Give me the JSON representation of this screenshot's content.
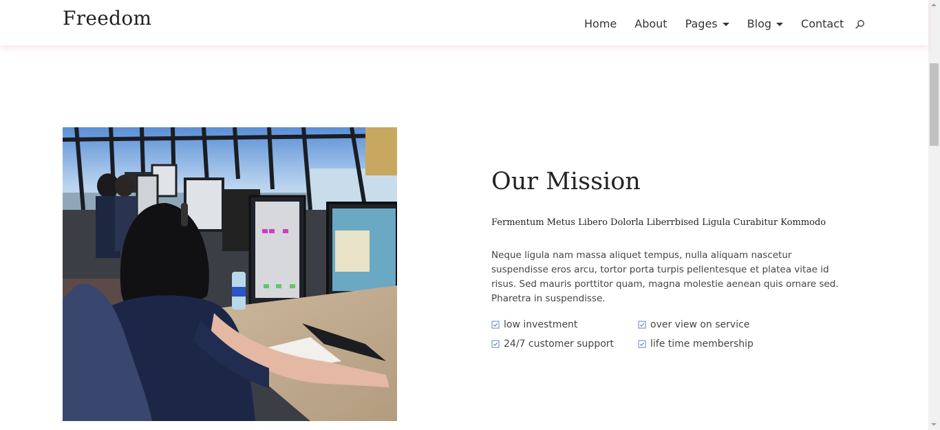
{
  "header": {
    "logo": "Freedom",
    "nav": [
      {
        "label": "Home",
        "dropdown": false
      },
      {
        "label": "About",
        "dropdown": false
      },
      {
        "label": "Pages",
        "dropdown": true
      },
      {
        "label": "Blog",
        "dropdown": true
      },
      {
        "label": "Contact",
        "dropdown": false
      }
    ],
    "search_icon": "search-icon"
  },
  "mission": {
    "title": "Our Mission",
    "subtitle": "Fermentum Metus Libero Dolorla Liberrbised Ligula Curabitur Kommodo",
    "paragraph": "Neque ligula nam massa aliquet tempus, nulla aliquam nascetur suspendisse eros arcu, tortor porta turpis pellentesque et platea vitae id risus. Sed mauris porttitor quam, magna molestie aenean quis ornare sed. Pharetra in suspendisse.",
    "features": [
      "low investment",
      "over view on service",
      "24/7 customer support",
      "life time membership"
    ],
    "feature_icon": "checkbox-icon",
    "image_icon": "air-traffic-control-photo"
  },
  "colors": {
    "accent": "#6a7fbf",
    "header_shadow": "#f3dfe2",
    "text": "#333333"
  }
}
